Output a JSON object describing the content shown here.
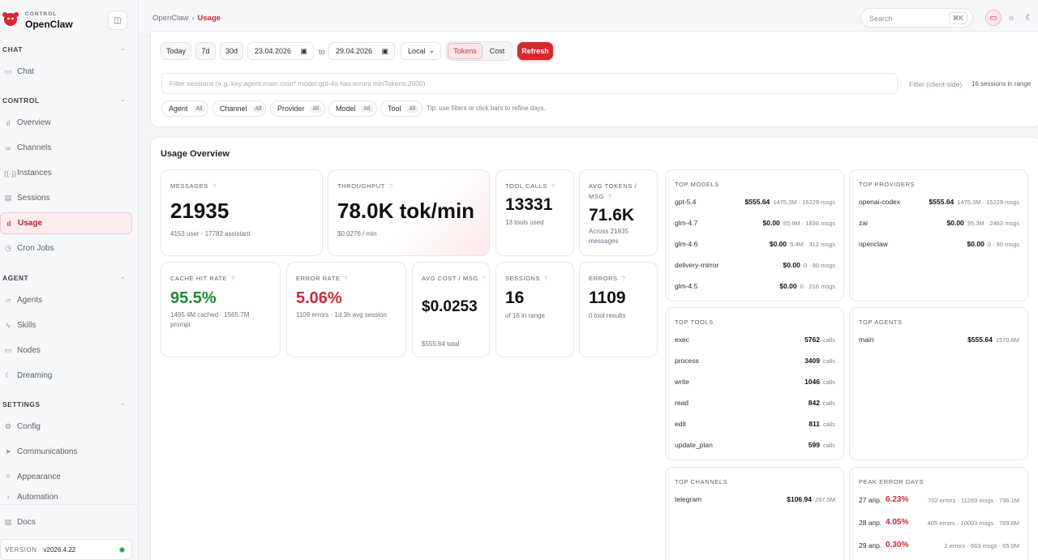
{
  "brand": {
    "small": "CONTROL",
    "name": "OpenClaw"
  },
  "sidebar": {
    "sections": [
      {
        "title": "CHAT",
        "items": [
          {
            "label": "Chat",
            "icon": "chat-bubble-icon"
          }
        ]
      },
      {
        "title": "CONTROL",
        "items": [
          {
            "label": "Overview",
            "icon": "bar-chart-icon"
          },
          {
            "label": "Channels",
            "icon": "link-icon"
          },
          {
            "label": "Instances",
            "icon": "signal-icon"
          },
          {
            "label": "Sessions",
            "icon": "document-icon"
          },
          {
            "label": "Usage",
            "icon": "bar-chart-icon",
            "active": true
          },
          {
            "label": "Cron Jobs",
            "icon": "clock-icon"
          }
        ]
      },
      {
        "title": "AGENT",
        "items": [
          {
            "label": "Agents",
            "icon": "folder-icon"
          },
          {
            "label": "Skills",
            "icon": "bolt-icon"
          },
          {
            "label": "Nodes",
            "icon": "monitor-icon"
          },
          {
            "label": "Dreaming",
            "icon": "moon-icon"
          }
        ]
      },
      {
        "title": "SETTINGS",
        "items": [
          {
            "label": "Config",
            "icon": "gear-icon"
          },
          {
            "label": "Communications",
            "icon": "send-icon"
          },
          {
            "label": "Appearance",
            "icon": "sparkle-icon"
          },
          {
            "label": "Automation",
            "icon": "chevron-icon"
          }
        ]
      }
    ],
    "docs": "Docs",
    "version_label": "VERSION",
    "version_value": "v2026.4.22",
    "status_color": "#22a34a"
  },
  "topbar": {
    "breadcrumb_root": "OpenClaw",
    "breadcrumb_sep": "›",
    "breadcrumb_current": "Usage",
    "search_placeholder": "Search",
    "search_shortcut": "⌘K"
  },
  "filters": {
    "range_buttons": [
      "Today",
      "7d",
      "30d"
    ],
    "date_from": "23.04.2026",
    "to_label": "to",
    "date_to": "29.04.2026",
    "timezone": "Local",
    "mode_options": [
      "Tokens",
      "Cost"
    ],
    "mode_selected": "Tokens",
    "refresh_label": "Refresh",
    "session_filter_placeholder": "Filter sessions (e.g. key:agent:main:cron* model:gpt-4o has:errors minTokens:2000)",
    "client_side_label": "Filter (client-side)",
    "sessions_in_range": "16 sessions in range",
    "chips": [
      {
        "label": "Agent",
        "value": "All"
      },
      {
        "label": "Channel",
        "value": "All"
      },
      {
        "label": "Provider",
        "value": "All"
      },
      {
        "label": "Model",
        "value": "All"
      },
      {
        "label": "Tool",
        "value": "All"
      }
    ],
    "tip": "Tip: use filters or click bars to refine days."
  },
  "overview": {
    "title": "Usage Overview",
    "stats": {
      "messages": {
        "label": "MESSAGES",
        "value": "21935",
        "sub": "4153 user · 17782 assistant"
      },
      "throughput": {
        "label": "THROUGHPUT",
        "value": "78.0K tok/min",
        "sub": "$0.0276 / min"
      },
      "tool_calls": {
        "label": "TOOL CALLS",
        "value": "13331",
        "sub": "13 tools used"
      },
      "avg_tokens": {
        "label": "AVG TOKENS / MSG",
        "value": "71.6K",
        "sub": "Across 21935 messages"
      },
      "cache_hit": {
        "label": "CACHE HIT RATE",
        "value": "95.5%",
        "sub": "1495.4M cached · 1565.7M prompt"
      },
      "error_rate": {
        "label": "ERROR RATE",
        "value": "5.06%",
        "sub": "1109 errors · 1d 3h avg session"
      },
      "avg_cost": {
        "label": "AVG COST / MSG",
        "value": "$0.0253",
        "sub": "$555.64 total"
      },
      "sessions": {
        "label": "SESSIONS",
        "value": "16",
        "sub": "of 16 in range"
      },
      "errors": {
        "label": "ERRORS",
        "value": "1109",
        "sub": "0 tool results"
      }
    },
    "top_models": {
      "title": "TOP MODELS",
      "rows": [
        {
          "name": "gpt-5.4",
          "amount": "$555.64",
          "meta": "1475.3M · 15229 msgs"
        },
        {
          "name": "glm-4.7",
          "amount": "$0.00",
          "meta": "85.9M · 1836 msgs"
        },
        {
          "name": "glm-4.6",
          "amount": "$0.00",
          "meta": "5.4M · 312 msgs"
        },
        {
          "name": "delivery-mirror",
          "amount": "$0.00",
          "meta": "0 · 90 msgs"
        },
        {
          "name": "glm-4.5",
          "amount": "$0.00",
          "meta": "0 · 216 msgs"
        }
      ]
    },
    "top_providers": {
      "title": "TOP PROVIDERS",
      "rows": [
        {
          "name": "openai-codex",
          "amount": "$555.64",
          "meta": "1475.3M · 15229 msgs"
        },
        {
          "name": "zai",
          "amount": "$0.00",
          "meta": "95.3M · 2463 msgs"
        },
        {
          "name": "openclaw",
          "amount": "$0.00",
          "meta": "0 · 90 msgs"
        }
      ]
    },
    "top_tools": {
      "title": "TOP TOOLS",
      "rows": [
        {
          "name": "exec",
          "amount": "5762",
          "meta": "calls"
        },
        {
          "name": "process",
          "amount": "3409",
          "meta": "calls"
        },
        {
          "name": "write",
          "amount": "1046",
          "meta": "calls"
        },
        {
          "name": "read",
          "amount": "842",
          "meta": "calls"
        },
        {
          "name": "edit",
          "amount": "811",
          "meta": "calls"
        },
        {
          "name": "update_plan",
          "amount": "599",
          "meta": "calls"
        }
      ]
    },
    "top_agents": {
      "title": "TOP AGENTS",
      "rows": [
        {
          "name": "main",
          "amount": "$555.64",
          "meta": "1570.6M"
        }
      ]
    },
    "top_channels": {
      "title": "TOP CHANNELS",
      "rows": [
        {
          "name": "telegram",
          "amount": "$106.94",
          "meta": "297.5M"
        }
      ]
    },
    "peak_error_days": {
      "title": "PEAK ERROR DAYS",
      "rows": [
        {
          "name": "27 апр.",
          "pct": "6.23%",
          "meta": "702 errors · 11269 msgs · 736.1M"
        },
        {
          "name": "28 апр.",
          "pct": "4.05%",
          "meta": "405 errors · 10003 msgs · 769.6M"
        },
        {
          "name": "29 апр.",
          "pct": "0.30%",
          "meta": "2 errors · 663 msgs · 65.0M"
        }
      ]
    }
  }
}
